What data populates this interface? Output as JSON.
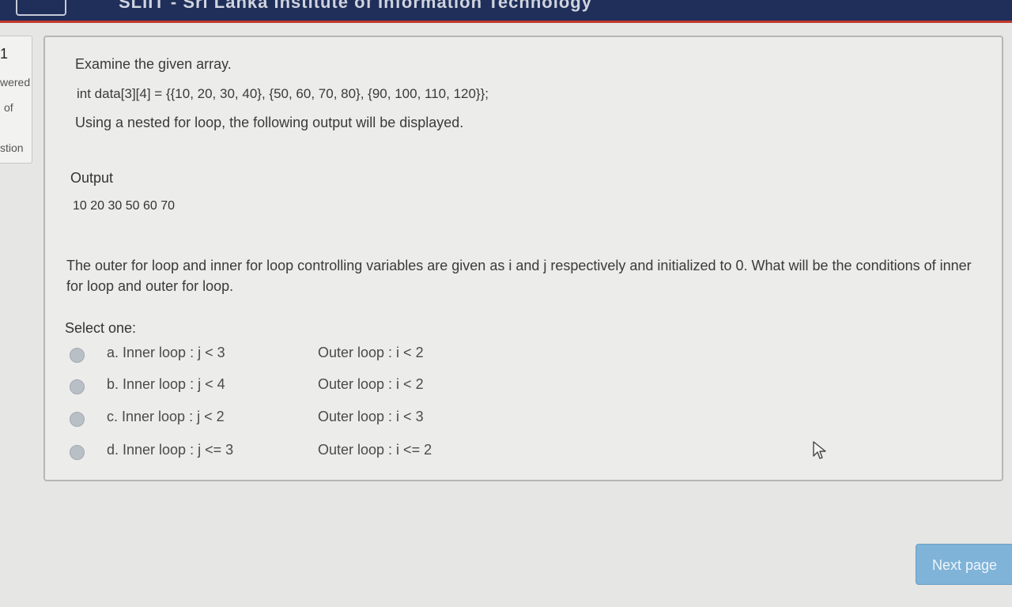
{
  "header": {
    "title": "SLIIT - Sri Lanka Institute of Information Technology"
  },
  "info": {
    "number": "1",
    "line1": "wered",
    "line2": "of",
    "line3": "stion"
  },
  "question": {
    "line1": "Examine the given array.",
    "code": "int data[3][4] = {{10, 20, 30, 40}, {50, 60, 70, 80}, {90, 100, 110, 120}};",
    "line3": "Using a nested for loop, the following output will be displayed.",
    "output_label": "Output",
    "output_value": "10 20 30 50 60 70",
    "prompt": "The outer for loop and inner for loop controlling variables are given as i and j respectively and initialized to 0. What will be the conditions of inner for loop and outer for loop.",
    "select_label": "Select one:"
  },
  "options": [
    {
      "inner": "a. Inner loop : j  < 3",
      "outer": "Outer loop :  i < 2"
    },
    {
      "inner": "b. Inner loop : j  < 4",
      "outer": "Outer loop :  i < 2"
    },
    {
      "inner": "c. Inner loop : j  < 2",
      "outer": "Outer loop :  i < 3"
    },
    {
      "inner": "d. Inner loop :  j  <=  3",
      "outer": "Outer loop :  i <= 2"
    }
  ],
  "footer": {
    "next_label": "Next page"
  },
  "colors": {
    "header_bg": "#1f2f5a",
    "header_accent": "#c0392b",
    "button_bg": "#7fb3d8"
  }
}
